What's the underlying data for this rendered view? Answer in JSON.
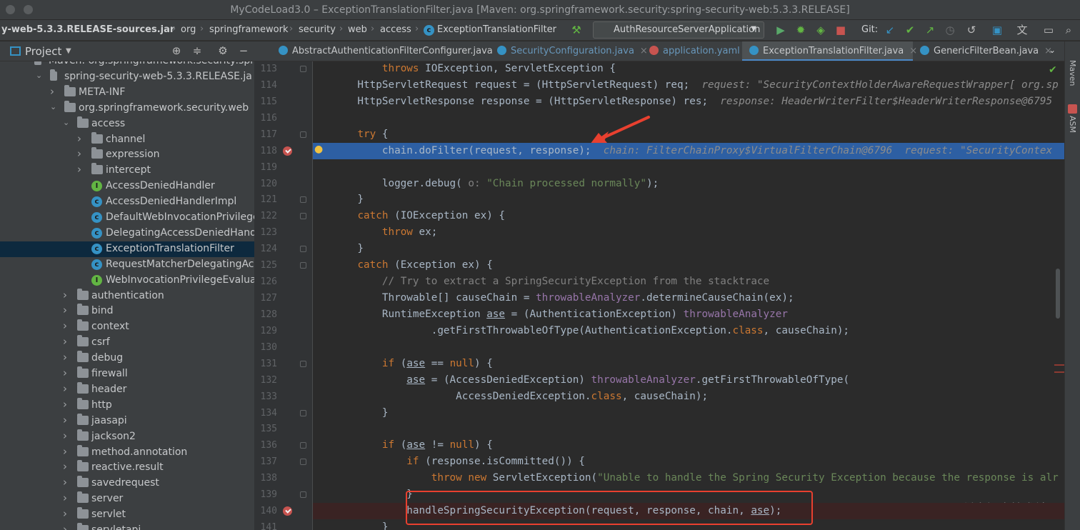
{
  "window": {
    "title": "MyCodeLoad3.0 – ExceptionTranslationFilter.java [Maven: org.springframework.security:spring-security-web:5.3.3.RELEASE]"
  },
  "navbar": {
    "crumbs": [
      "y-web-5.3.3.RELEASE-sources.jar",
      "org",
      "springframework",
      "security",
      "web",
      "access",
      "ExceptionTranslationFilter"
    ],
    "run_config": "AuthResourceServerApplication",
    "git_label": "Git:"
  },
  "project": {
    "title": "Project",
    "tree": [
      {
        "label": "Maven: org.springframework.security:spr",
        "depth": 0,
        "kind": "text"
      },
      {
        "label": "spring-security-web-5.3.3.RELEASE.ja",
        "depth": 1,
        "kind": "jar",
        "open": true
      },
      {
        "label": "META-INF",
        "depth": 2,
        "kind": "folder",
        "open": false
      },
      {
        "label": "org.springframework.security.web",
        "depth": 2,
        "kind": "folder",
        "open": true
      },
      {
        "label": "access",
        "depth": 3,
        "kind": "folder",
        "open": true
      },
      {
        "label": "channel",
        "depth": 4,
        "kind": "folder",
        "open": false
      },
      {
        "label": "expression",
        "depth": 4,
        "kind": "folder",
        "open": false
      },
      {
        "label": "intercept",
        "depth": 4,
        "kind": "folder",
        "open": false
      },
      {
        "label": "AccessDeniedHandler",
        "depth": 4,
        "kind": "interface"
      },
      {
        "label": "AccessDeniedHandlerImpl",
        "depth": 4,
        "kind": "class"
      },
      {
        "label": "DefaultWebInvocationPrivilege",
        "depth": 4,
        "kind": "class"
      },
      {
        "label": "DelegatingAccessDeniedHand",
        "depth": 4,
        "kind": "class"
      },
      {
        "label": "ExceptionTranslationFilter",
        "depth": 4,
        "kind": "class",
        "selected": true
      },
      {
        "label": "RequestMatcherDelegatingAc",
        "depth": 4,
        "kind": "class"
      },
      {
        "label": "WebInvocationPrivilegeEvalua",
        "depth": 4,
        "kind": "interface"
      },
      {
        "label": "authentication",
        "depth": 3,
        "kind": "folder",
        "open": false
      },
      {
        "label": "bind",
        "depth": 3,
        "kind": "folder",
        "open": false
      },
      {
        "label": "context",
        "depth": 3,
        "kind": "folder",
        "open": false
      },
      {
        "label": "csrf",
        "depth": 3,
        "kind": "folder",
        "open": false
      },
      {
        "label": "debug",
        "depth": 3,
        "kind": "folder",
        "open": false
      },
      {
        "label": "firewall",
        "depth": 3,
        "kind": "folder",
        "open": false
      },
      {
        "label": "header",
        "depth": 3,
        "kind": "folder",
        "open": false
      },
      {
        "label": "http",
        "depth": 3,
        "kind": "folder",
        "open": false
      },
      {
        "label": "jaasapi",
        "depth": 3,
        "kind": "folder",
        "open": false
      },
      {
        "label": "jackson2",
        "depth": 3,
        "kind": "folder",
        "open": false
      },
      {
        "label": "method.annotation",
        "depth": 3,
        "kind": "folder",
        "open": false
      },
      {
        "label": "reactive.result",
        "depth": 3,
        "kind": "folder",
        "open": false
      },
      {
        "label": "savedrequest",
        "depth": 3,
        "kind": "folder",
        "open": false
      },
      {
        "label": "server",
        "depth": 3,
        "kind": "folder",
        "open": false
      },
      {
        "label": "servlet",
        "depth": 3,
        "kind": "folder",
        "open": false
      },
      {
        "label": "servletapi",
        "depth": 3,
        "kind": "folder",
        "open": false
      }
    ]
  },
  "tabs": [
    {
      "label": "AbstractAuthenticationFilterConfigurer.java",
      "color": "#3592c4"
    },
    {
      "label": "SecurityConfiguration.java",
      "color": "#3592c4"
    },
    {
      "label": "application.yaml",
      "color": "#c75450"
    },
    {
      "label": "ExceptionTranslationFilter.java",
      "color": "#3592c4",
      "active": true
    },
    {
      "label": "GenericFilterBean.java",
      "color": "#3592c4"
    }
  ],
  "right_bar": {
    "maven": "Maven",
    "asm": "ASM"
  },
  "editor": {
    "lines": [
      {
        "n": "113",
        "html": "        <span class=\"kw\">throws</span> IOException, ServletException {"
      },
      {
        "n": "114",
        "html": "    HttpServletRequest request = (HttpServletRequest) req;  <span class=\"hint\">request: \"SecurityContextHolderAwareRequestWrapper[ org.sp</span>"
      },
      {
        "n": "115",
        "html": "    HttpServletResponse response = (HttpServletResponse) res;  <span class=\"hint\">response: HeaderWriterFilter$HeaderWriterResponse@6795</span>"
      },
      {
        "n": "116",
        "html": ""
      },
      {
        "n": "117",
        "html": "    <span class=\"kw\">try</span> {"
      },
      {
        "n": "118",
        "html": "        chain.doFilter(request, response);  <span class=\"hint\">chain: FilterChainProxy$VirtualFilterChain@6796  request: \"SecurityContex</span>"
      },
      {
        "n": "119",
        "html": ""
      },
      {
        "n": "120",
        "html": "        logger.debug( <span class=\"cm\">o:</span> <span class=\"st\">\"Chain processed normally\"</span>);"
      },
      {
        "n": "121",
        "html": "    }"
      },
      {
        "n": "122",
        "html": "    <span class=\"kw\">catch</span> (IOException ex) {"
      },
      {
        "n": "123",
        "html": "        <span class=\"kw\">throw</span> ex;"
      },
      {
        "n": "124",
        "html": "    }"
      },
      {
        "n": "125",
        "html": "    <span class=\"kw\">catch</span> (Exception ex) {"
      },
      {
        "n": "126",
        "html": "        <span class=\"cm\">// Try to extract a SpringSecurityException from the stacktrace</span>"
      },
      {
        "n": "127",
        "html": "        Throwable[] causeChain = <span class=\"fd\">throwableAnalyzer</span>.determineCauseChain(ex);"
      },
      {
        "n": "128",
        "html": "        RuntimeException <span class=\"u\">ase</span> = (AuthenticationException) <span class=\"fd\">throwableAnalyzer</span>"
      },
      {
        "n": "129",
        "html": "                .getFirstThrowableOfType(AuthenticationException.<span class=\"kw\">class</span>, causeChain);"
      },
      {
        "n": "130",
        "html": ""
      },
      {
        "n": "131",
        "html": "        <span class=\"kw\">if</span> (<span class=\"u\">ase</span> == <span class=\"kw\">null</span>) {"
      },
      {
        "n": "132",
        "html": "            <span class=\"u\">ase</span> = (AccessDeniedException) <span class=\"fd\">throwableAnalyzer</span>.getFirstThrowableOfType("
      },
      {
        "n": "133",
        "html": "                    AccessDeniedException.<span class=\"kw\">class</span>, causeChain);"
      },
      {
        "n": "134",
        "html": "        }"
      },
      {
        "n": "135",
        "html": ""
      },
      {
        "n": "136",
        "html": "        <span class=\"kw\">if</span> (<span class=\"u\">ase</span> != <span class=\"kw\">null</span>) {"
      },
      {
        "n": "137",
        "html": "            <span class=\"kw\">if</span> (response.isCommitted()) {"
      },
      {
        "n": "138",
        "html": "                <span class=\"kw\">throw new</span> ServletException(<span class=\"st\">\"Unable to handle the Spring Security Exception because the response is alr</span>"
      },
      {
        "n": "139",
        "html": "            }"
      },
      {
        "n": "140",
        "html": "            handleSpringSecurityException(request, response, chain, <span class=\"u\">ase</span>);"
      },
      {
        "n": "141",
        "html": "        }"
      }
    ]
  },
  "watermark": "@稀土掘金技术社区"
}
